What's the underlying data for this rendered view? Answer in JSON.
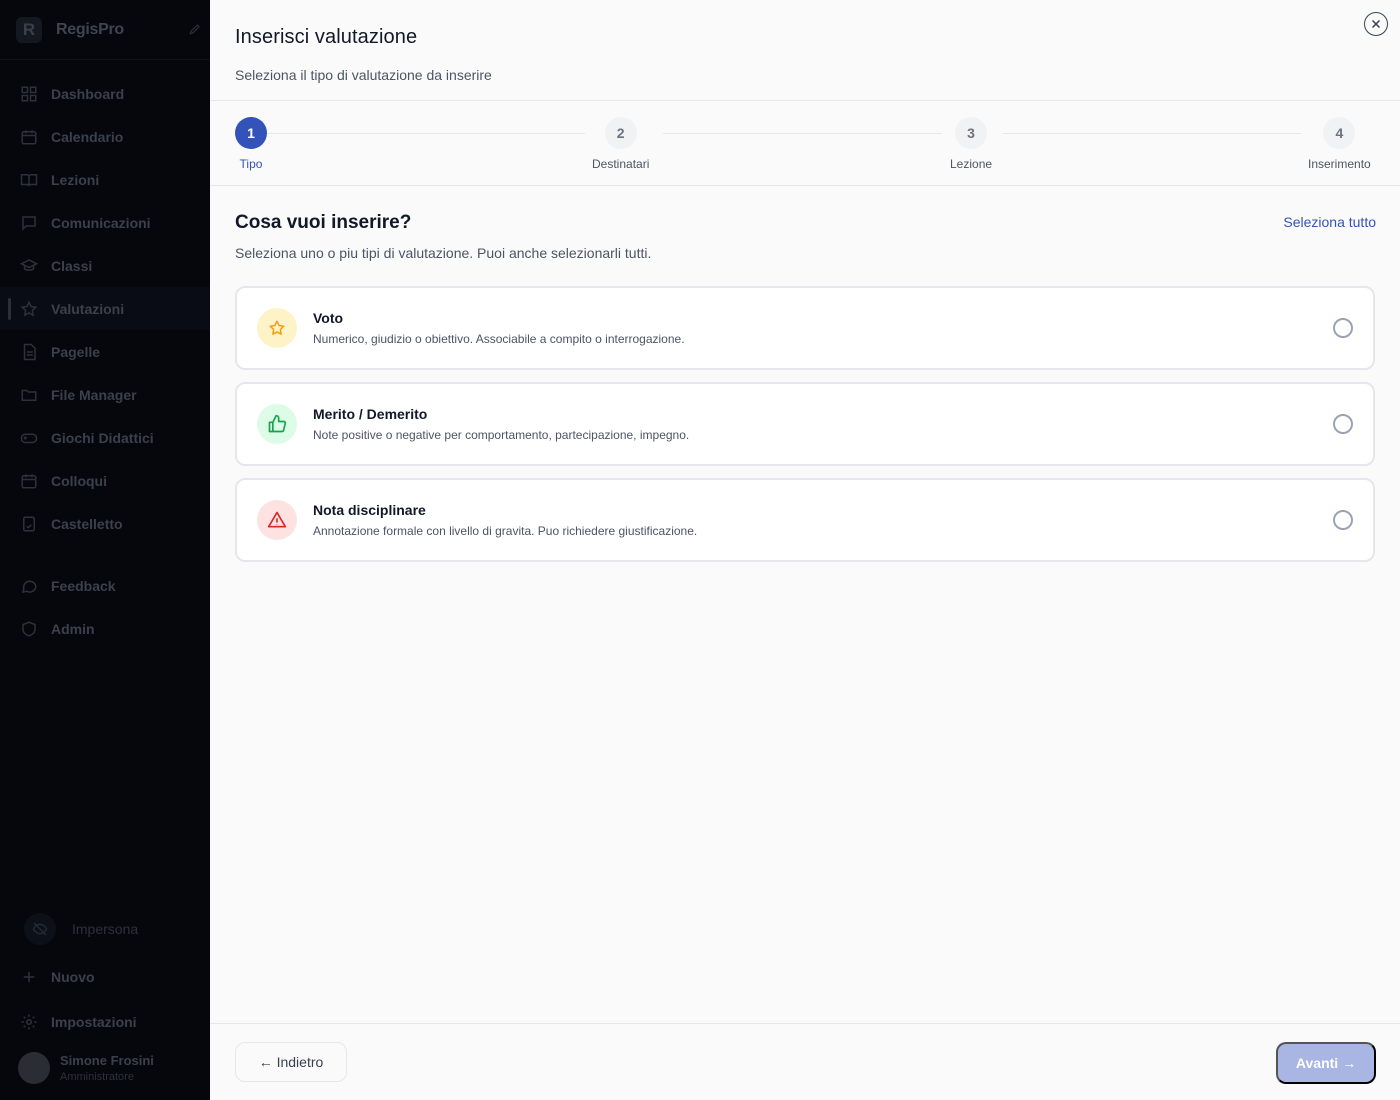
{
  "sidebar": {
    "brand": "RegisPro",
    "items": [
      {
        "label": "Dashboard",
        "icon": "grid-icon"
      },
      {
        "label": "Calendario",
        "icon": "calendar-icon"
      },
      {
        "label": "Lezioni",
        "icon": "book-icon"
      },
      {
        "label": "Comunicazioni",
        "icon": "message-icon"
      },
      {
        "label": "Classi",
        "icon": "graduation-cap-icon"
      },
      {
        "label": "Valutazioni",
        "icon": "star-icon",
        "active": true
      },
      {
        "label": "Pagelle",
        "icon": "document-icon"
      },
      {
        "label": "File Manager",
        "icon": "folder-icon"
      },
      {
        "label": "Giochi Didattici",
        "icon": "gamepad-icon"
      },
      {
        "label": "Colloqui",
        "icon": "calendar-check-icon"
      },
      {
        "label": "Castelletto",
        "icon": "clipboard-icon"
      }
    ],
    "secondary": [
      {
        "label": "Feedback",
        "icon": "chat-icon"
      },
      {
        "label": "Admin",
        "icon": "shield-icon"
      }
    ],
    "impersona": "Impersona",
    "nuovo": "Nuovo",
    "impostazioni": "Impostazioni",
    "user": {
      "name": "Simone Frosini",
      "role": "Amministratore"
    }
  },
  "modal": {
    "title": "Inserisci valutazione",
    "subtitle": "Seleziona il tipo di valutazione da inserire",
    "steps": [
      {
        "number": "1",
        "label": "Tipo",
        "active": true
      },
      {
        "number": "2",
        "label": "Destinatari"
      },
      {
        "number": "3",
        "label": "Lezione"
      },
      {
        "number": "4",
        "label": "Inserimento"
      }
    ],
    "question": "Cosa vuoi inserire?",
    "question_sub": "Seleziona uno o piu tipi di valutazione. Puoi anche selezionarli tutti.",
    "select_all": "Seleziona tutto",
    "options": [
      {
        "title": "Voto",
        "description": "Numerico, giudizio o obiettivo. Associabile a compito o interrogazione.",
        "icon": "star-icon",
        "color": "#f59e0b",
        "bg": "#fef3c7"
      },
      {
        "title": "Merito / Demerito",
        "description": "Note positive o negative per comportamento, partecipazione, impegno.",
        "icon": "thumbs-up-icon",
        "color": "#16a34a",
        "bg": "#dcfce7"
      },
      {
        "title": "Nota disciplinare",
        "description": "Annotazione formale con livello di gravita. Puo richiedere giustificazione.",
        "icon": "warning-icon",
        "color": "#dc2626",
        "bg": "#fee2e2"
      }
    ],
    "back": "← Indietro",
    "next": "Avanti →"
  },
  "colors": {
    "accent": "#3453b8",
    "next_disabled": "#a9b5e3"
  }
}
